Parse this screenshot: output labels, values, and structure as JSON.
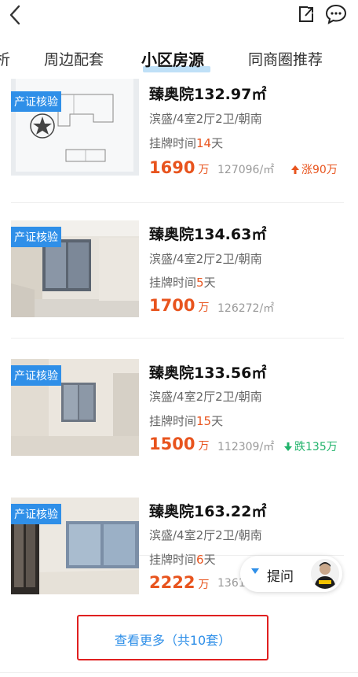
{
  "header": {
    "back_icon": "chevron-left-icon",
    "share_icon": "share-icon",
    "chat_icon": "chat-bubble-icon"
  },
  "tabs": [
    {
      "label": "析"
    },
    {
      "label": "周边配套"
    },
    {
      "label": "小区房源"
    },
    {
      "label": "同商圈推荐"
    }
  ],
  "active_tab": "小区房源",
  "listings": [
    {
      "badge": "产证核验",
      "title": "臻奥院132.97㎡",
      "spec": "滨盛/4室2厅2卫/朝南",
      "days_prefix": "挂牌时间",
      "days": "14",
      "days_suffix": "天",
      "price": "1690",
      "price_unit": "万",
      "unit_price": "127096/㎡",
      "change": "涨90万",
      "change_dir": "up"
    },
    {
      "badge": "产证核验",
      "title": "臻奥院134.63㎡",
      "spec": "滨盛/4室2厅2卫/朝南",
      "days_prefix": "挂牌时间",
      "days": "5",
      "days_suffix": "天",
      "price": "1700",
      "price_unit": "万",
      "unit_price": "126272/㎡",
      "change": "",
      "change_dir": ""
    },
    {
      "badge": "产证核验",
      "title": "臻奥院133.56㎡",
      "spec": "滨盛/4室2厅2卫/朝南",
      "days_prefix": "挂牌时间",
      "days": "15",
      "days_suffix": "天",
      "price": "1500",
      "price_unit": "万",
      "unit_price": "112309/㎡",
      "change": "跌135万",
      "change_dir": "down"
    },
    {
      "badge": "产证核验",
      "title": "臻奥院163.22㎡",
      "spec": "滨盛/4室2厅2卫/朝南",
      "days_prefix": "挂牌时间",
      "days": "6",
      "days_suffix": "天",
      "price": "2222",
      "price_unit": "万",
      "unit_price": "1361",
      "change": "",
      "change_dir": ""
    }
  ],
  "ask": {
    "label": "提问",
    "avatar_icon": "agent-avatar"
  },
  "more": {
    "label": "查看更多（共10套）"
  },
  "colors": {
    "accent": "#2f8fe8",
    "price": "#e8541e",
    "up": "#e8541e",
    "down": "#21b36b",
    "highlight_border": "#e02020"
  }
}
